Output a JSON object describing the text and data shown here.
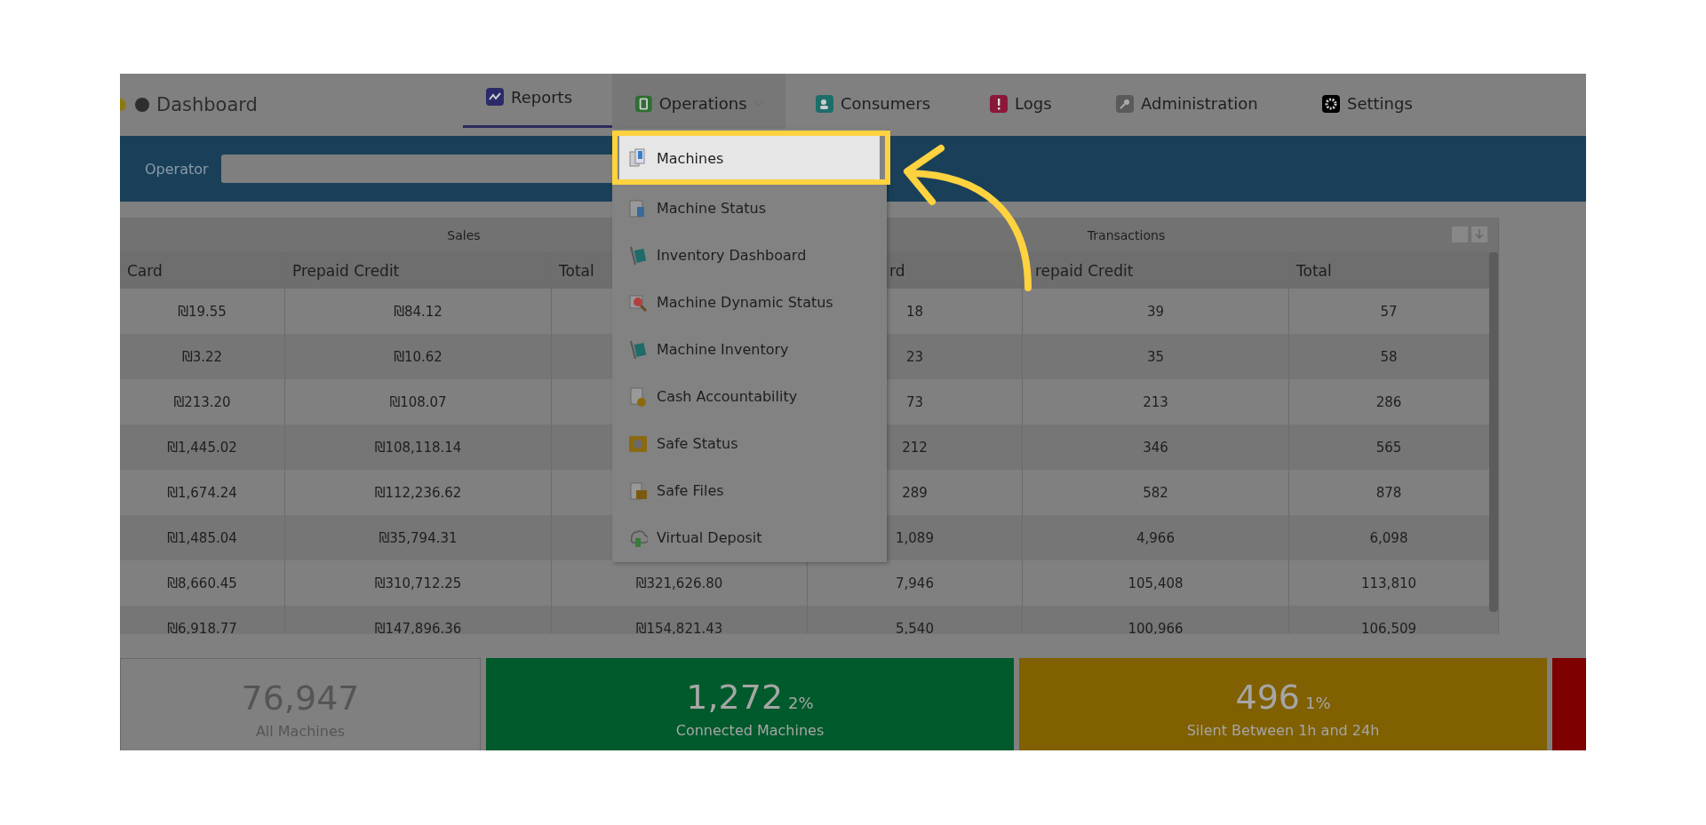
{
  "nav": {
    "brand": "Dashboard",
    "tabs": [
      {
        "label": "Reports",
        "selected": true,
        "expanded": false
      },
      {
        "label": "Operations",
        "selected": false,
        "expanded": true
      },
      {
        "label": "Consumers",
        "selected": false,
        "expanded": false
      },
      {
        "label": "Logs",
        "selected": false,
        "expanded": false
      },
      {
        "label": "Administration",
        "selected": false,
        "expanded": false
      },
      {
        "label": "Settings",
        "selected": false,
        "expanded": false
      }
    ]
  },
  "filter": {
    "label": "Operator"
  },
  "table": {
    "groups": [
      "Sales",
      "Transactions"
    ],
    "columns": [
      "Card",
      "Prepaid Credit",
      "Total",
      "rd",
      "repaid Credit",
      "Total"
    ],
    "rows": [
      [
        "₪19.55",
        "₪84.12",
        null,
        "18",
        "39",
        "57"
      ],
      [
        "₪3.22",
        "₪10.62",
        null,
        "23",
        "35",
        "58"
      ],
      [
        "₪213.20",
        "₪108.07",
        null,
        "73",
        "213",
        "286"
      ],
      [
        "₪1,445.02",
        "₪108,118.14",
        null,
        "212",
        "346",
        "565"
      ],
      [
        "₪1,674.24",
        "₪112,236.62",
        null,
        "289",
        "582",
        "878"
      ],
      [
        "₪1,485.04",
        "₪35,794.31",
        null,
        "1,089",
        "4,966",
        "6,098"
      ],
      [
        "₪8,660.45",
        "₪310,712.25",
        "₪321,626.80",
        "7,946",
        "105,408",
        "113,810"
      ],
      [
        "₪6,918.77",
        "₪147,896.36",
        "₪154,821.43",
        "5,540",
        "100,966",
        "106,509"
      ]
    ]
  },
  "menu": [
    {
      "label": "Machines",
      "selected": true
    },
    {
      "label": "Machine Status",
      "selected": false
    },
    {
      "label": "Inventory Dashboard",
      "selected": false
    },
    {
      "label": "Machine Dynamic Status",
      "selected": false
    },
    {
      "label": "Machine Inventory",
      "selected": false
    },
    {
      "label": "Cash Accountability",
      "selected": false
    },
    {
      "label": "Safe Status",
      "selected": false
    },
    {
      "label": "Safe Files",
      "selected": false
    },
    {
      "label": "Virtual Deposit",
      "selected": false
    }
  ],
  "cards": [
    {
      "value": "76,947",
      "label": "All Machines",
      "color": "#808080"
    },
    {
      "value": "1,272",
      "percent": "2%",
      "label": "Connected Machines",
      "color": "#005a2b"
    },
    {
      "value": "496",
      "percent": "1%",
      "label": "Silent Between 1h and 24h",
      "color": "#806000"
    },
    {
      "color": "#7f0000"
    }
  ]
}
